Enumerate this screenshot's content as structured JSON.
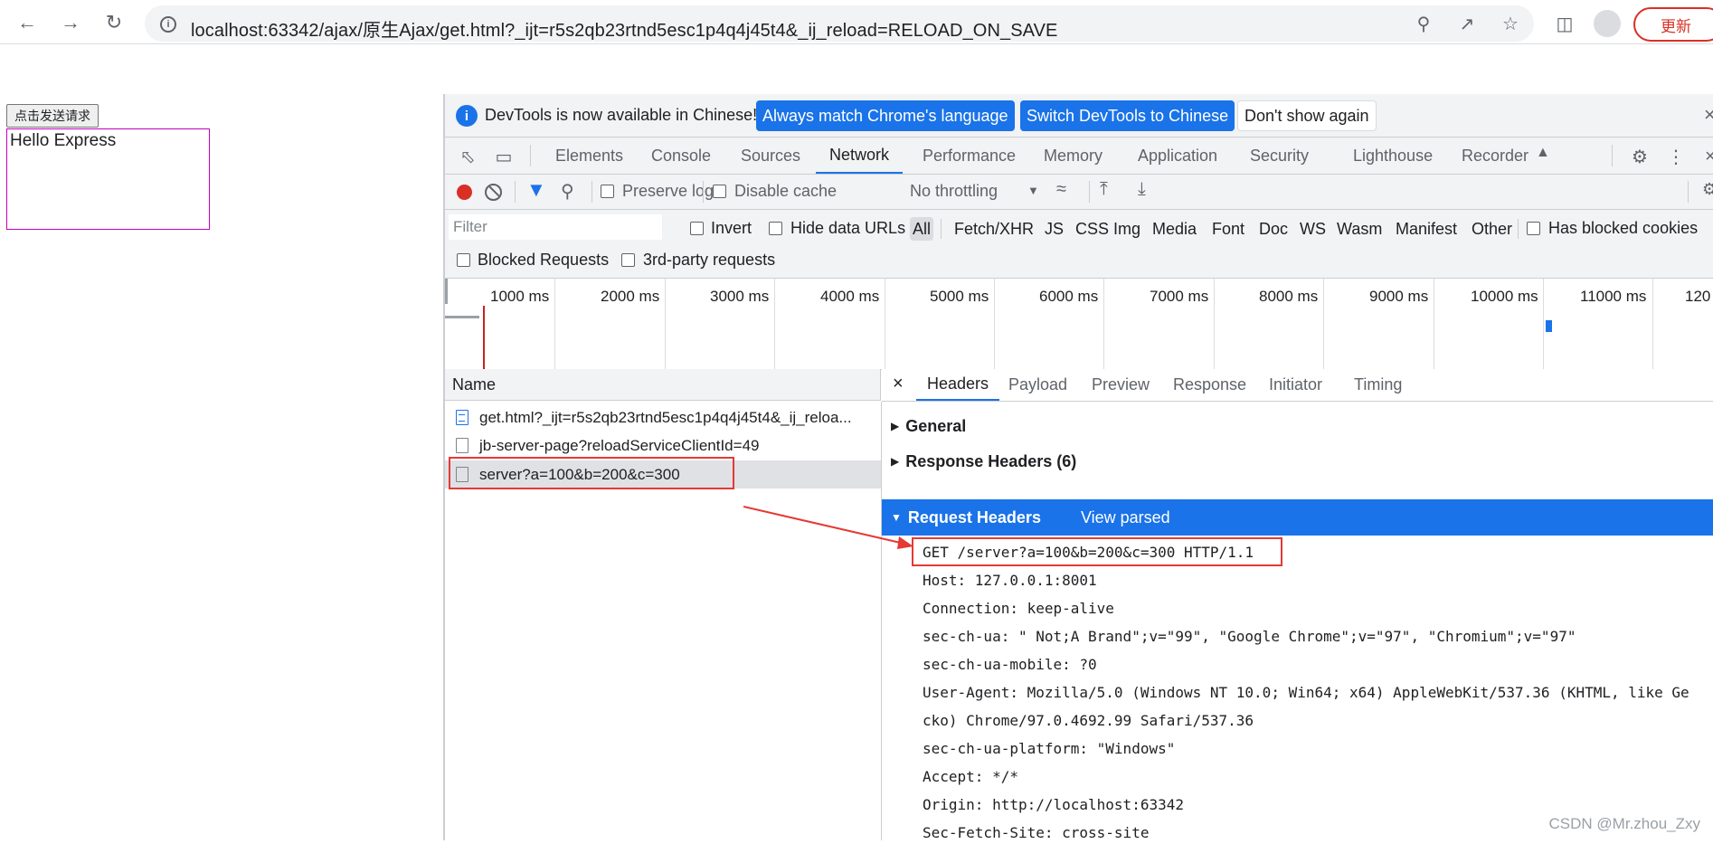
{
  "browser": {
    "url": "localhost:63342/ajax/原生Ajax/get.html?_ijt=r5s2qb23rtnd5esc1p4q4j45t4&_ij_reload=RELOAD_ON_SAVE",
    "update_label": "更新"
  },
  "page": {
    "button_label": "点击发送请求",
    "result_text": "Hello Express"
  },
  "devtools": {
    "infobar": {
      "message": "DevTools is now available in Chinese!",
      "btn_match": "Always match Chrome's language",
      "btn_switch": "Switch DevTools to Chinese",
      "btn_dismiss": "Don't show again"
    },
    "tabs": [
      "Elements",
      "Console",
      "Sources",
      "Network",
      "Performance",
      "Memory",
      "Application",
      "Security",
      "Lighthouse",
      "Recorder"
    ],
    "active_tab": "Network",
    "toolbar": {
      "preserve_log": "Preserve log",
      "disable_cache": "Disable cache",
      "throttling": "No throttling"
    },
    "filter": {
      "placeholder": "Filter",
      "invert": "Invert",
      "hide_data_urls": "Hide data URLs",
      "types": [
        "All",
        "Fetch/XHR",
        "JS",
        "CSS",
        "Img",
        "Media",
        "Font",
        "Doc",
        "WS",
        "Wasm",
        "Manifest",
        "Other"
      ],
      "active_type": "All",
      "has_blocked_cookies": "Has blocked cookies",
      "blocked_requests": "Blocked Requests",
      "third_party": "3rd-party requests"
    },
    "timeline_labels": [
      "1000 ms",
      "2000 ms",
      "3000 ms",
      "4000 ms",
      "5000 ms",
      "6000 ms",
      "7000 ms",
      "8000 ms",
      "9000 ms",
      "10000 ms",
      "11000 ms",
      "120"
    ],
    "requests": {
      "column_name": "Name",
      "rows": [
        "get.html?_ijt=r5s2qb23rtnd5esc1p4q4j45t4&_ij_reloa...",
        "jb-server-page?reloadServiceClientId=49",
        "server?a=100&b=200&c=300"
      ]
    },
    "detail": {
      "close_glyph": "×",
      "tabs": [
        "Headers",
        "Payload",
        "Preview",
        "Response",
        "Initiator",
        "Timing"
      ],
      "active_tab": "Headers",
      "general": "General",
      "response_headers": "Response Headers (6)",
      "request_headers": "Request Headers",
      "view_parsed": "View parsed",
      "raw_lines": [
        "GET /server?a=100&b=200&c=300 HTTP/1.1",
        "Host: 127.0.0.1:8001",
        "Connection: keep-alive",
        "sec-ch-ua: \" Not;A Brand\";v=\"99\", \"Google Chrome\";v=\"97\", \"Chromium\";v=\"97\"",
        "sec-ch-ua-mobile: ?0",
        "User-Agent: Mozilla/5.0 (Windows NT 10.0; Win64; x64) AppleWebKit/537.36 (KHTML, like Ge",
        "cko) Chrome/97.0.4692.99 Safari/537.36",
        "sec-ch-ua-platform: \"Windows\"",
        "Accept: */*",
        "Origin: http://localhost:63342",
        "Sec-Fetch-Site: cross-site"
      ]
    }
  },
  "watermark": "CSDN @Mr.zhou_Zxy",
  "colors": {
    "accent": "#1a73e8",
    "annotation_red": "#e53935",
    "record_red": "#d93025"
  }
}
